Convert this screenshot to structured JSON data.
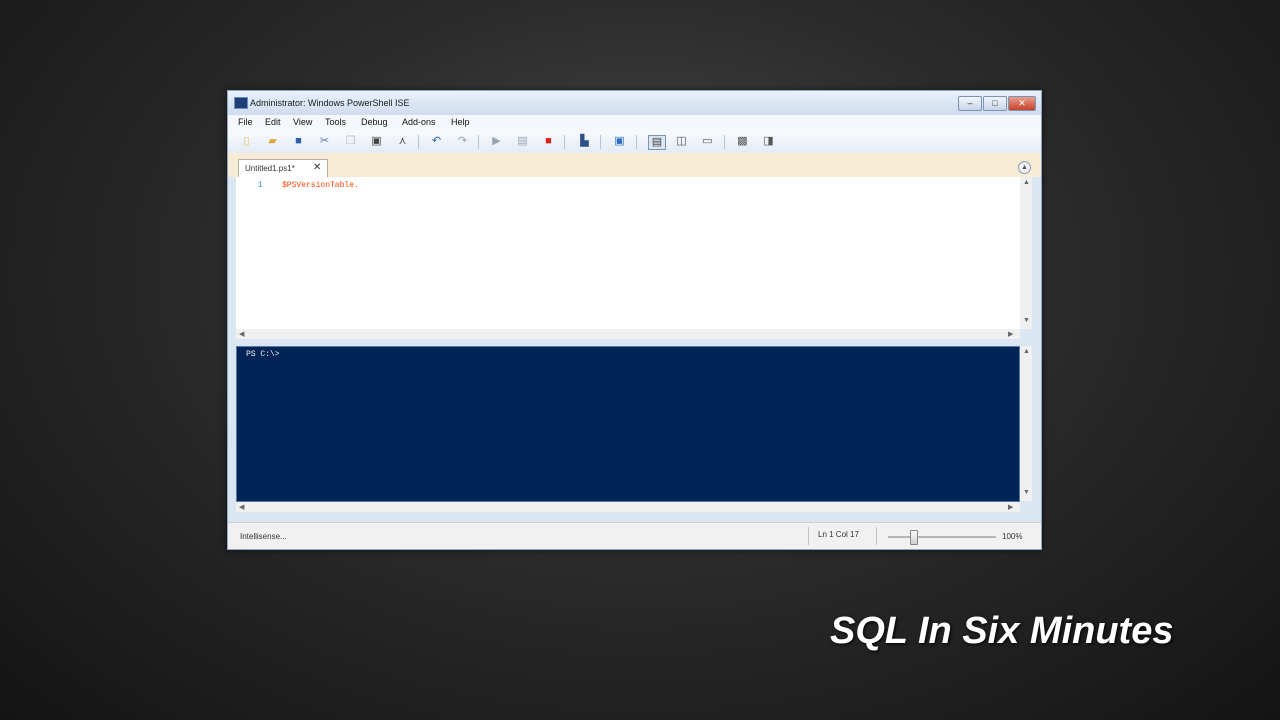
{
  "window": {
    "title": "Administrator: Windows PowerShell ISE"
  },
  "menu": [
    "File",
    "Edit",
    "View",
    "Tools",
    "Debug",
    "Add-ons",
    "Help"
  ],
  "toolbar": {
    "icons": [
      "new-file-icon",
      "open-folder-icon",
      "save-icon",
      "cut-icon",
      "copy-icon",
      "paste-icon",
      "clear-icon",
      "undo-icon",
      "redo-icon",
      "run-script-icon",
      "run-selection-icon",
      "stop-icon",
      "new-remote-tab-icon",
      "powershell-icon",
      "show-script-top-icon",
      "show-script-right-icon",
      "show-script-max-icon",
      "commands-icon",
      "show-addon-icon"
    ]
  },
  "tab": {
    "label": "Untitled1.ps1*",
    "close": "✕"
  },
  "editor": {
    "line_number": "1",
    "code": "$PSVersionTable."
  },
  "console": {
    "prompt": "PS C:\\>"
  },
  "status": {
    "message": "Intellisense...",
    "position": "Ln 1  Col 17",
    "zoom": "100%",
    "zoom_level": 0.2
  },
  "caption": "SQL In Six Minutes",
  "colors": {
    "console_bg": "#012456",
    "code": "#ff4500",
    "line_number": "#2b91af"
  }
}
